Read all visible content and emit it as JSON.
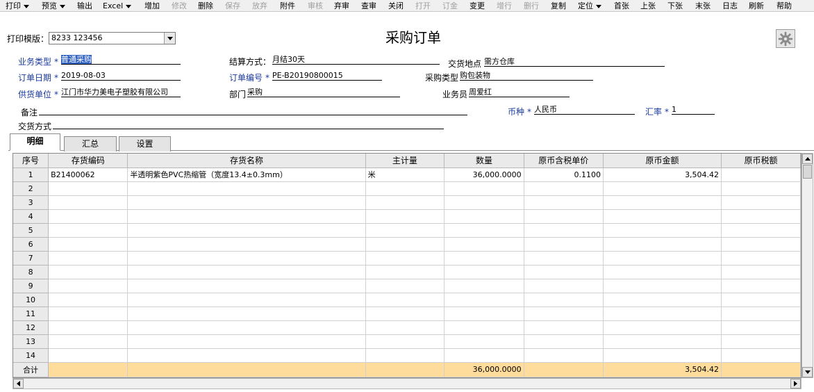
{
  "toolbar": {
    "items": [
      {
        "label": "打印",
        "dropdown": true,
        "enabled": true
      },
      {
        "label": "预览",
        "dropdown": true,
        "enabled": true
      },
      {
        "label": "输出",
        "dropdown": false,
        "enabled": true
      },
      {
        "label": "Excel",
        "dropdown": true,
        "enabled": true
      },
      {
        "label": "增加",
        "dropdown": false,
        "enabled": true
      },
      {
        "label": "修改",
        "dropdown": false,
        "enabled": false
      },
      {
        "label": "删除",
        "dropdown": false,
        "enabled": true
      },
      {
        "label": "保存",
        "dropdown": false,
        "enabled": false
      },
      {
        "label": "放弃",
        "dropdown": false,
        "enabled": false
      },
      {
        "label": "附件",
        "dropdown": false,
        "enabled": true
      },
      {
        "label": "审核",
        "dropdown": false,
        "enabled": false
      },
      {
        "label": "弃审",
        "dropdown": false,
        "enabled": true
      },
      {
        "label": "查审",
        "dropdown": false,
        "enabled": true
      },
      {
        "label": "关闭",
        "dropdown": false,
        "enabled": true
      },
      {
        "label": "打开",
        "dropdown": false,
        "enabled": false
      },
      {
        "label": "订金",
        "dropdown": false,
        "enabled": false
      },
      {
        "label": "变更",
        "dropdown": false,
        "enabled": true
      },
      {
        "label": "增行",
        "dropdown": false,
        "enabled": false
      },
      {
        "label": "删行",
        "dropdown": false,
        "enabled": false
      },
      {
        "label": "复制",
        "dropdown": false,
        "enabled": true
      },
      {
        "label": "定位",
        "dropdown": true,
        "enabled": true
      },
      {
        "label": "首张",
        "dropdown": false,
        "enabled": true
      },
      {
        "label": "上张",
        "dropdown": false,
        "enabled": true
      },
      {
        "label": "下张",
        "dropdown": false,
        "enabled": true
      },
      {
        "label": "末张",
        "dropdown": false,
        "enabled": true
      },
      {
        "label": "日志",
        "dropdown": false,
        "enabled": true
      },
      {
        "label": "刷新",
        "dropdown": false,
        "enabled": true
      },
      {
        "label": "帮助",
        "dropdown": false,
        "enabled": true
      }
    ]
  },
  "print_template": {
    "label": "打印模版：",
    "value": "8233 123456"
  },
  "title": "采购订单",
  "header": {
    "business_type": {
      "label": "业务类型",
      "value": "普通采购"
    },
    "settlement": {
      "label": "结算方式：",
      "value": "月结30天"
    },
    "delivery_place": {
      "label": "交货地点",
      "value": "需方仓库"
    },
    "order_date": {
      "label": "订单日期",
      "value": "2019-08-03"
    },
    "order_no": {
      "label": "订单编号",
      "value": "PE-B20190800015"
    },
    "purchase_type": {
      "label": "采购类型",
      "value": "购包装物"
    },
    "supplier": {
      "label": "供货单位",
      "value": "江门市华力美电子塑胶有限公司"
    },
    "department": {
      "label": "部门",
      "value": "采购"
    },
    "salesperson": {
      "label": "业务员",
      "value": "周爱红"
    },
    "remark": {
      "label": "备注",
      "value": ""
    },
    "currency": {
      "label": "币种",
      "value": "人民币"
    },
    "rate": {
      "label": "汇率",
      "value": "1"
    },
    "delivery_method": {
      "label": "交货方式",
      "value": ""
    }
  },
  "tabs": [
    "明细",
    "汇总",
    "设置"
  ],
  "grid": {
    "columns": [
      "序号",
      "存货编码",
      "存货名称",
      "主计量",
      "数量",
      "原币含税单价",
      "原币金额",
      "原币税额"
    ],
    "rows": [
      [
        "1",
        "B21400062",
        "半透明紫色PVC热缩管（宽度13.4±0.3mm）",
        "米",
        "36,000.0000",
        "0.1100",
        "3,504.42",
        ""
      ],
      [
        "2",
        "",
        "",
        "",
        "",
        "",
        "",
        ""
      ],
      [
        "3",
        "",
        "",
        "",
        "",
        "",
        "",
        ""
      ],
      [
        "4",
        "",
        "",
        "",
        "",
        "",
        "",
        ""
      ],
      [
        "5",
        "",
        "",
        "",
        "",
        "",
        "",
        ""
      ],
      [
        "6",
        "",
        "",
        "",
        "",
        "",
        "",
        ""
      ],
      [
        "7",
        "",
        "",
        "",
        "",
        "",
        "",
        ""
      ],
      [
        "8",
        "",
        "",
        "",
        "",
        "",
        "",
        ""
      ],
      [
        "9",
        "",
        "",
        "",
        "",
        "",
        "",
        ""
      ],
      [
        "10",
        "",
        "",
        "",
        "",
        "",
        "",
        ""
      ],
      [
        "11",
        "",
        "",
        "",
        "",
        "",
        "",
        ""
      ],
      [
        "12",
        "",
        "",
        "",
        "",
        "",
        "",
        ""
      ],
      [
        "13",
        "",
        "",
        "",
        "",
        "",
        "",
        ""
      ],
      [
        "14",
        "",
        "",
        "",
        "",
        "",
        "",
        ""
      ]
    ],
    "total": {
      "label": "合计",
      "quantity": "36,000.0000",
      "amount": "3,504.42"
    }
  }
}
